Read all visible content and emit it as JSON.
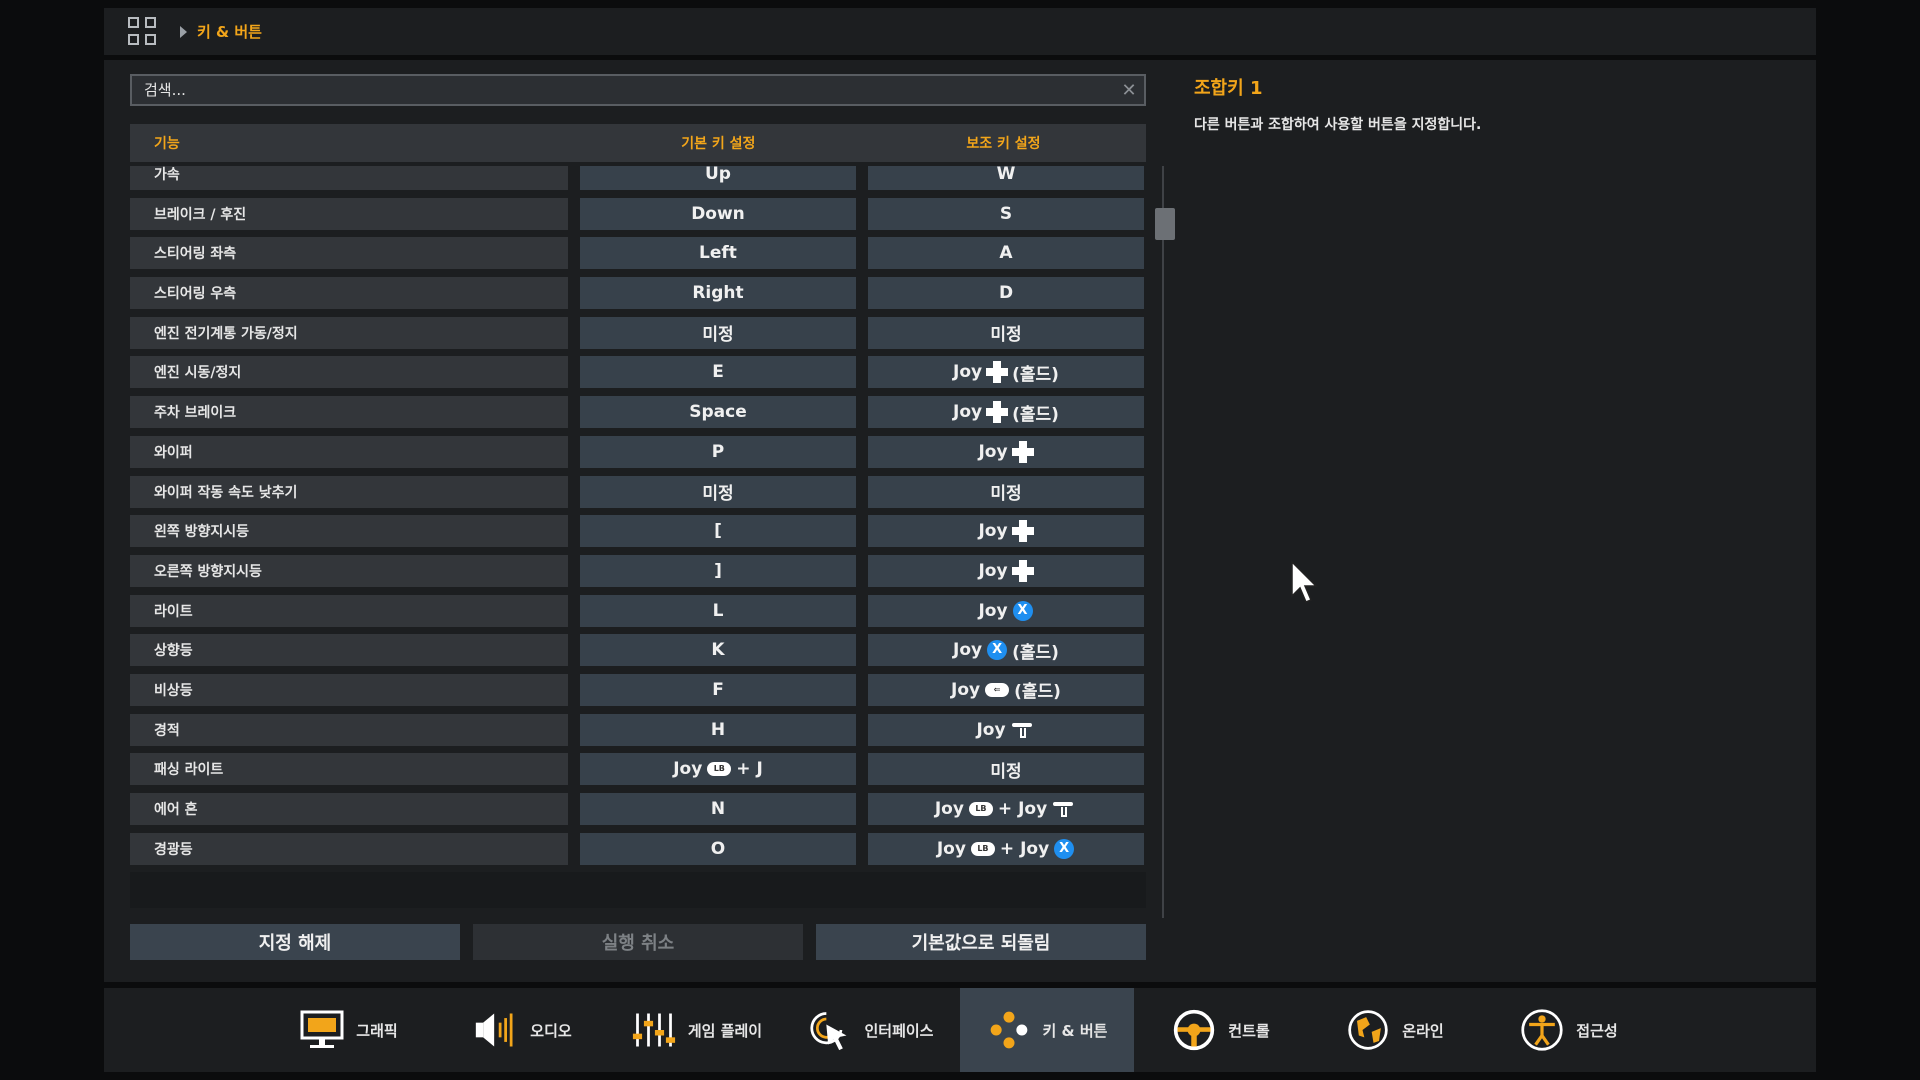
{
  "breadcrumb": {
    "current": "키 & 버튼"
  },
  "search": {
    "placeholder": "검색..."
  },
  "table": {
    "headers": {
      "function": "기능",
      "primary": "기본 키 설정",
      "secondary": "보조 키 설정"
    },
    "rows": [
      {
        "function": "가속",
        "primary": [
          {
            "t": "text",
            "v": "Up"
          }
        ],
        "secondary": [
          {
            "t": "text",
            "v": "W"
          }
        ]
      },
      {
        "function": "브레이크 / 후진",
        "primary": [
          {
            "t": "text",
            "v": "Down"
          }
        ],
        "secondary": [
          {
            "t": "text",
            "v": "S"
          }
        ]
      },
      {
        "function": "스티어링 좌측",
        "primary": [
          {
            "t": "text",
            "v": "Left"
          }
        ],
        "secondary": [
          {
            "t": "text",
            "v": "A"
          }
        ]
      },
      {
        "function": "스티어링 우측",
        "primary": [
          {
            "t": "text",
            "v": "Right"
          }
        ],
        "secondary": [
          {
            "t": "text",
            "v": "D"
          }
        ]
      },
      {
        "function": "엔진 전기계통 가동/정지",
        "primary": [
          {
            "t": "text",
            "v": "미정"
          }
        ],
        "secondary": [
          {
            "t": "text",
            "v": "미정"
          }
        ]
      },
      {
        "function": "엔진 시동/정지",
        "primary": [
          {
            "t": "text",
            "v": "E"
          }
        ],
        "secondary": [
          {
            "t": "text",
            "v": "Joy"
          },
          {
            "t": "icon",
            "v": "dpad-icon"
          },
          {
            "t": "text",
            "v": "(홀드)"
          }
        ]
      },
      {
        "function": "주차 브레이크",
        "primary": [
          {
            "t": "text",
            "v": "Space"
          }
        ],
        "secondary": [
          {
            "t": "text",
            "v": "Joy"
          },
          {
            "t": "icon",
            "v": "dpad-icon"
          },
          {
            "t": "text",
            "v": "(홀드)"
          }
        ]
      },
      {
        "function": "와이퍼",
        "primary": [
          {
            "t": "text",
            "v": "P"
          }
        ],
        "secondary": [
          {
            "t": "text",
            "v": "Joy"
          },
          {
            "t": "icon",
            "v": "dpad-icon"
          }
        ]
      },
      {
        "function": "와이퍼 작동 속도 낮추기",
        "primary": [
          {
            "t": "text",
            "v": "미정"
          }
        ],
        "secondary": [
          {
            "t": "text",
            "v": "미정"
          }
        ]
      },
      {
        "function": "왼쪽 방향지시등",
        "primary": [
          {
            "t": "text",
            "v": "["
          }
        ],
        "secondary": [
          {
            "t": "text",
            "v": "Joy"
          },
          {
            "t": "icon",
            "v": "dpad-icon"
          }
        ]
      },
      {
        "function": "오른쪽 방향지시등",
        "primary": [
          {
            "t": "text",
            "v": "]"
          }
        ],
        "secondary": [
          {
            "t": "text",
            "v": "Joy"
          },
          {
            "t": "icon",
            "v": "dpad-icon"
          }
        ]
      },
      {
        "function": "라이트",
        "primary": [
          {
            "t": "text",
            "v": "L"
          }
        ],
        "secondary": [
          {
            "t": "text",
            "v": "Joy"
          },
          {
            "t": "icon",
            "v": "x-button-icon",
            "label": "X"
          }
        ]
      },
      {
        "function": "상향등",
        "primary": [
          {
            "t": "text",
            "v": "K"
          }
        ],
        "secondary": [
          {
            "t": "text",
            "v": "Joy"
          },
          {
            "t": "icon",
            "v": "x-button-icon",
            "label": "X"
          },
          {
            "t": "text",
            "v": "(홀드)"
          }
        ]
      },
      {
        "function": "비상등",
        "primary": [
          {
            "t": "text",
            "v": "F"
          }
        ],
        "secondary": [
          {
            "t": "text",
            "v": "Joy"
          },
          {
            "t": "icon",
            "v": "view-button-icon",
            "label": "⇐"
          },
          {
            "t": "text",
            "v": "(홀드)"
          }
        ]
      },
      {
        "function": "경적",
        "primary": [
          {
            "t": "text",
            "v": "H"
          }
        ],
        "secondary": [
          {
            "t": "text",
            "v": "Joy"
          },
          {
            "t": "icon",
            "v": "right-trigger-icon"
          }
        ]
      },
      {
        "function": "패싱 라이트",
        "primary": [
          {
            "t": "text",
            "v": "Joy"
          },
          {
            "t": "icon",
            "v": "lb-button-icon",
            "label": "LB"
          },
          {
            "t": "text",
            "v": "+ J"
          }
        ],
        "secondary": [
          {
            "t": "text",
            "v": "미정"
          }
        ]
      },
      {
        "function": "에어 혼",
        "primary": [
          {
            "t": "text",
            "v": "N"
          }
        ],
        "secondary": [
          {
            "t": "text",
            "v": "Joy"
          },
          {
            "t": "icon",
            "v": "lb-button-icon",
            "label": "LB"
          },
          {
            "t": "text",
            "v": "+ Joy"
          },
          {
            "t": "icon",
            "v": "right-trigger-icon"
          }
        ]
      },
      {
        "function": "경광등",
        "primary": [
          {
            "t": "text",
            "v": "O"
          }
        ],
        "secondary": [
          {
            "t": "text",
            "v": "Joy"
          },
          {
            "t": "icon",
            "v": "lb-button-icon",
            "label": "LB"
          },
          {
            "t": "text",
            "v": "+ Joy"
          },
          {
            "t": "icon",
            "v": "x-button-icon",
            "label": "X"
          }
        ]
      }
    ]
  },
  "buttons": {
    "unassign": "지정 해제",
    "undo": "실행 취소",
    "reset": "기본값으로 되돌림"
  },
  "detail": {
    "title": "조합키 1",
    "description": "다른 버튼과 조합하여 사용할 버튼을 지정합니다."
  },
  "nav": {
    "active_index": 4,
    "items": [
      {
        "label": "그래픽",
        "icon": "monitor-icon"
      },
      {
        "label": "오디오",
        "icon": "speaker-icon"
      },
      {
        "label": "게임 플레이",
        "icon": "sliders-icon"
      },
      {
        "label": "인터페이스",
        "icon": "pointer-icon"
      },
      {
        "label": "키 & 버튼",
        "icon": "buttons-icon"
      },
      {
        "label": "컨트롤",
        "icon": "steering-wheel-icon"
      },
      {
        "label": "온라인",
        "icon": "globe-icon"
      },
      {
        "label": "접근성",
        "icon": "accessibility-icon"
      }
    ]
  },
  "colors": {
    "accent": "#f2a51a",
    "panel": "#1c1e20",
    "key_cell": "#37414b",
    "row_cell": "#33363a",
    "joy_x": "#1f8ff0"
  }
}
